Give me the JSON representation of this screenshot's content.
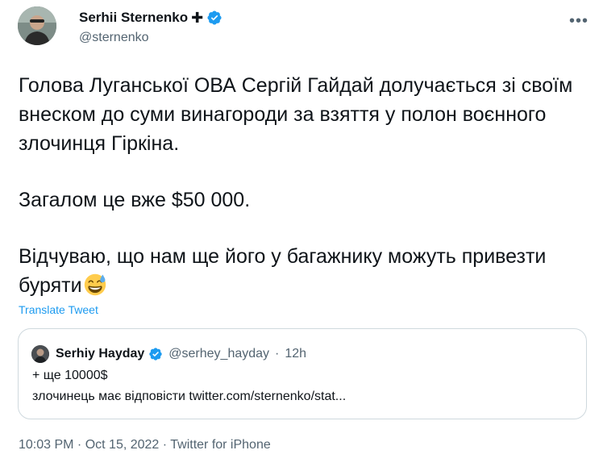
{
  "author": {
    "name": "Serhii Sternenko",
    "name_suffix": "✚",
    "handle": "@sternenko"
  },
  "tweet": {
    "paragraph1": "Голова Луганської ОВА Сергій Гайдай долучається зі своїм внеском до суми винагороди за взяття у полон воєнного злочинця Гіркіна.",
    "paragraph2": "Загалом це вже $50 000.",
    "paragraph3": "Відчуваю, що нам ще його у багажнику можуть привезти буряти",
    "emoji": "grinning-face-with-sweat-emoji",
    "translate_label": "Translate Tweet"
  },
  "quote": {
    "name": "Serhiy Hayday",
    "handle": "@serhey_hayday",
    "separator": "·",
    "age": "12h",
    "line1": "+ ще 10000$",
    "line2": "злочинець має відповісти twitter.com/sternenko/stat..."
  },
  "footer": {
    "timestamp": "10:03 PM · Oct 15, 2022 · Twitter for iPhone"
  },
  "colors": {
    "accent": "#1d9bf0",
    "secondary_text": "#536471",
    "border": "#cfd9de"
  }
}
